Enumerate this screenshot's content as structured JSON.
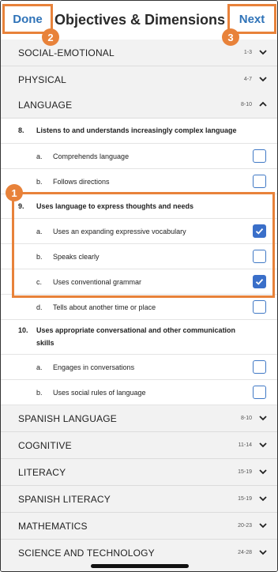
{
  "header": {
    "title": "Objectives & Dimensions",
    "done_label": "Done",
    "next_label": "Next"
  },
  "callouts": [
    "1",
    "2",
    "3"
  ],
  "sections_top": [
    {
      "label": "SOCIAL-EMOTIONAL",
      "range": "1-3",
      "expanded": false
    },
    {
      "label": "PHYSICAL",
      "range": "4-7",
      "expanded": false
    },
    {
      "label": "LANGUAGE",
      "range": "8-10",
      "expanded": true
    }
  ],
  "objectives": [
    {
      "number": "8.",
      "text": "Listens to and understands increasingly complex language",
      "dimensions": [
        {
          "letter": "a.",
          "text": "Comprehends language",
          "checked": false
        },
        {
          "letter": "b.",
          "text": "Follows directions",
          "checked": false
        }
      ]
    },
    {
      "number": "9.",
      "text": "Uses language to express thoughts and needs",
      "dimensions": [
        {
          "letter": "a.",
          "text": "Uses an expanding expressive vocabulary",
          "checked": true
        },
        {
          "letter": "b.",
          "text": "Speaks clearly",
          "checked": false
        },
        {
          "letter": "c.",
          "text": "Uses conventional grammar",
          "checked": true
        },
        {
          "letter": "d.",
          "text": "Tells about another time or place",
          "checked": false
        }
      ]
    },
    {
      "number": "10.",
      "text": "Uses appropriate conversational and other communication skills",
      "dimensions": [
        {
          "letter": "a.",
          "text": "Engages in conversations",
          "checked": false
        },
        {
          "letter": "b.",
          "text": "Uses social rules of language",
          "checked": false
        }
      ]
    }
  ],
  "sections_bottom": [
    {
      "label": "SPANISH LANGUAGE",
      "range": "8-10",
      "expanded": false
    },
    {
      "label": "COGNITIVE",
      "range": "11-14",
      "expanded": false
    },
    {
      "label": "LITERACY",
      "range": "15-19",
      "expanded": false
    },
    {
      "label": "SPANISH LITERACY",
      "range": "15-19",
      "expanded": false
    },
    {
      "label": "MATHEMATICS",
      "range": "20-23",
      "expanded": false
    },
    {
      "label": "SCIENCE AND TECHNOLOGY",
      "range": "24-28",
      "expanded": false
    }
  ],
  "colors": {
    "accent_blue": "#2f73b8",
    "checkbox_blue": "#3a6fc9",
    "callout_orange": "#e8823a",
    "section_bg": "#f2f2f2"
  },
  "icons": {
    "chevron_collapsed": "chevron-down-icon",
    "chevron_expanded": "chevron-up-icon",
    "check": "checkmark-icon"
  }
}
